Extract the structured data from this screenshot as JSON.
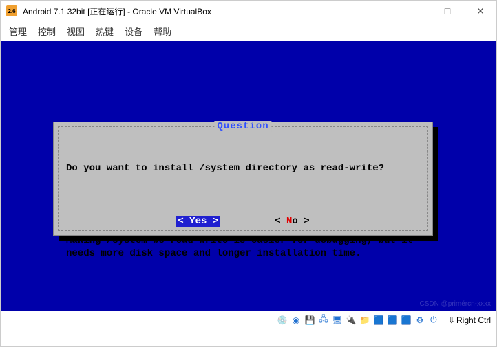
{
  "titlebar": {
    "title": "Android 7.1 32bit [正在运行] - Oracle VM VirtualBox",
    "icon_label": "2.6"
  },
  "win_controls": {
    "min": "—",
    "max": "□",
    "close": "✕"
  },
  "menubar": [
    "管理",
    "控制",
    "视图",
    "热键",
    "设备",
    "帮助"
  ],
  "dialog": {
    "title": "Question",
    "line1": "Do you want to install /system directory as read-write?",
    "line2": "Making /system be read-write is easier for debugging, but it needs more disk space and longer installation time.",
    "yes_open": "<",
    "yes_label": " Yes ",
    "yes_close": ">",
    "no_open": "<",
    "no_letter": " N",
    "no_rest": "o  ",
    "no_close": ">"
  },
  "status": {
    "host_key": "Right Ctrl",
    "icons": [
      "💿",
      "◉",
      "💾",
      "🖧",
      "🖥",
      "🔌",
      "📁",
      "🟦",
      "🟦",
      "🟦",
      "⚙",
      "⏻"
    ]
  },
  "watermark": "CSDN @primércn‑xxxx"
}
